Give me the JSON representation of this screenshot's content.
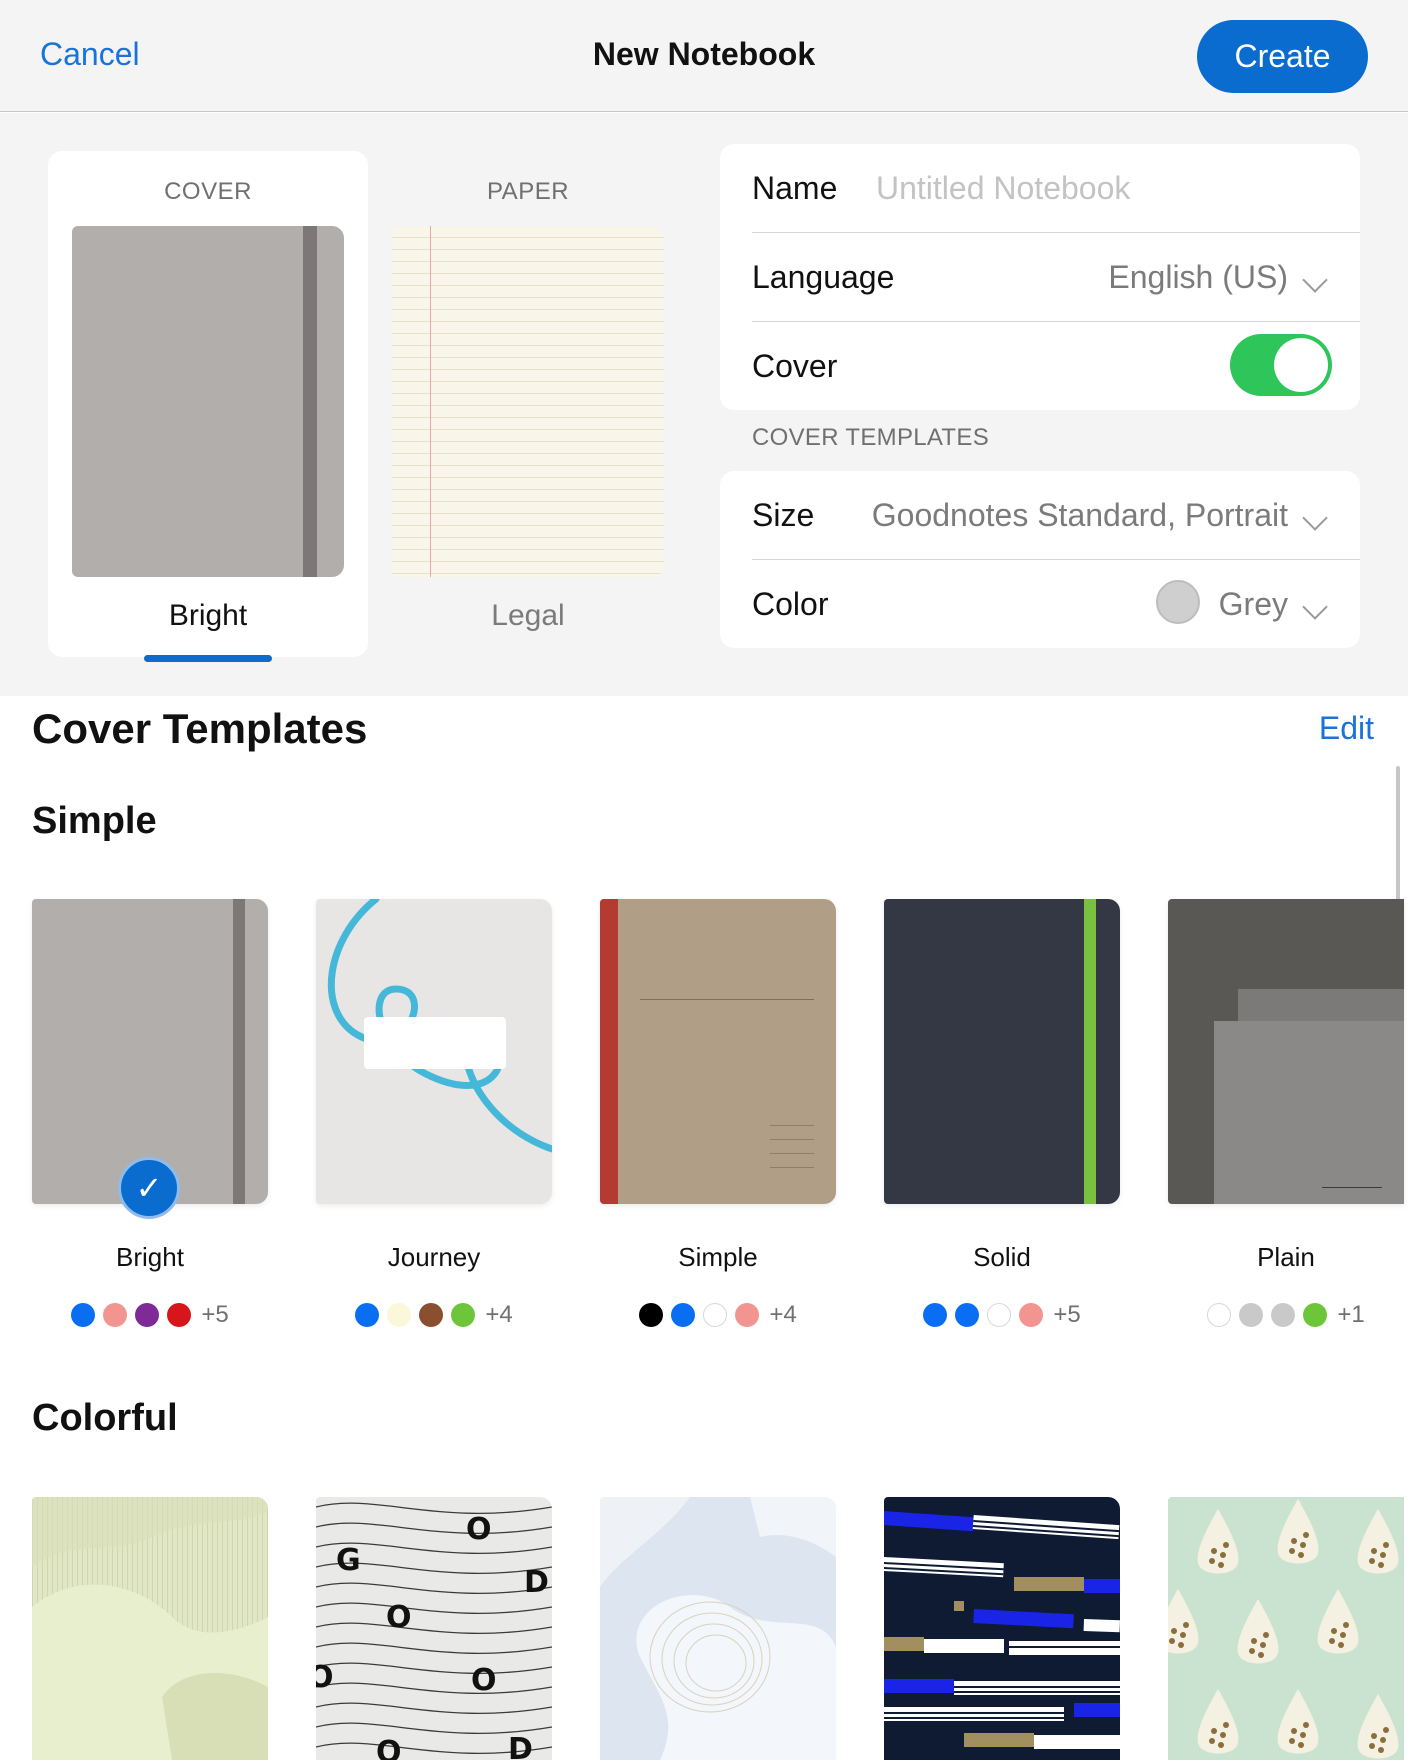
{
  "nav": {
    "cancel_label": "Cancel",
    "title": "New Notebook",
    "create_label": "Create"
  },
  "preview": {
    "cover_heading": "COVER",
    "paper_heading": "PAPER",
    "cover_name": "Bright",
    "paper_name": "Legal",
    "selected": "cover"
  },
  "form": {
    "name_label": "Name",
    "name_placeholder": "Untitled Notebook",
    "name_value": "",
    "language_label": "Language",
    "language_value": "English (US)",
    "cover_label": "Cover",
    "cover_enabled": true,
    "cover_templates_caption": "COVER TEMPLATES",
    "size_label": "Size",
    "size_value": "Goodnotes Standard, Portrait",
    "color_label": "Color",
    "color_value": "Grey",
    "color_swatch": "#cfcfd0"
  },
  "templates": {
    "title": "Cover Templates",
    "edit_label": "Edit",
    "groups": [
      {
        "title": "Simple",
        "items": [
          {
            "name": "Bright",
            "selected": true,
            "colors": [
              "#0a6ef2",
              "#f29490",
              "#7e2a97",
              "#d9151c"
            ],
            "more": "+5"
          },
          {
            "name": "Journey",
            "selected": false,
            "colors": [
              "#0a6ef2",
              "#fbf7d9",
              "#8a4f2e",
              "#6dc63a"
            ],
            "more": "+4"
          },
          {
            "name": "Simple",
            "selected": false,
            "colors": [
              "#000000",
              "#0a6ef2",
              "#ffffff",
              "#f29490"
            ],
            "more": "+4"
          },
          {
            "name": "Solid",
            "selected": false,
            "colors": [
              "#0a6ef2",
              "#0a6ef2",
              "#ffffff",
              "#f29490"
            ],
            "more": "+5"
          },
          {
            "name": "Plain",
            "selected": false,
            "colors": [
              "#ffffff",
              "#c9c9c9",
              "#c9c9c9",
              "#6dc63a"
            ],
            "more": "+1"
          }
        ]
      },
      {
        "title": "Colorful",
        "items": [
          {
            "pattern": "green-waves"
          },
          {
            "pattern": "good-letters",
            "letters": [
              "G",
              "O",
              "O",
              "D",
              "O",
              "O",
              "O",
              "D"
            ]
          },
          {
            "pattern": "blue-marble"
          },
          {
            "pattern": "navy-stripes"
          },
          {
            "pattern": "mint-drops"
          }
        ]
      }
    ]
  },
  "accent_color": "#0a6ccf",
  "toggle_color": "#2ec55a"
}
